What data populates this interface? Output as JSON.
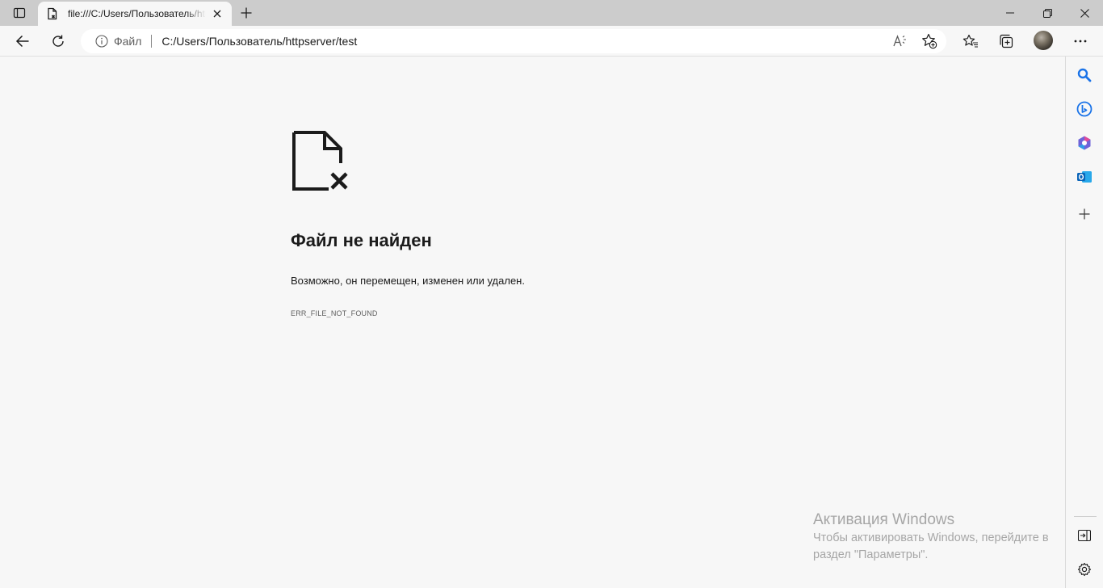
{
  "tabstrip": {
    "tab_title": "file:///C:/Users/Пользователь/httpserver/test"
  },
  "toolbar": {
    "site_info_label": "Файл",
    "address": "C:/Users/Пользователь/httpserver/test"
  },
  "error": {
    "title": "Файл не найден",
    "description": "Возможно, он перемещен, изменен или удален.",
    "code": "ERR_FILE_NOT_FOUND"
  },
  "watermark": {
    "title": "Активация Windows",
    "text": "Чтобы активировать Windows, перейдите в раздел \"Параметры\"."
  },
  "icons": {
    "tab_actions": "tab-actions-icon",
    "favicon": "file-icon",
    "close_tab": "close-icon",
    "new_tab": "plus-icon",
    "minimize": "minimize-icon",
    "restore": "restore-icon",
    "close_window": "close-icon",
    "back": "back-arrow-icon",
    "refresh": "refresh-icon",
    "info": "info-icon",
    "read_aloud": "read-aloud-icon",
    "add_favorite": "star-plus-icon",
    "favorites": "favorites-icon",
    "collections": "collections-icon",
    "more": "more-icon",
    "sidebar_search": "search-icon",
    "sidebar_bing": "bing-icon",
    "sidebar_m365": "office-icon",
    "sidebar_outlook": "outlook-icon",
    "sidebar_add": "plus-icon",
    "sidebar_hide": "hide-sidebar-icon",
    "sidebar_settings": "gear-icon",
    "error_image": "file-missing-icon"
  },
  "colors": {
    "accent_blue": "#1a73e8",
    "page_background": "#f7f7f7",
    "tabstrip_background": "#cccccc"
  }
}
